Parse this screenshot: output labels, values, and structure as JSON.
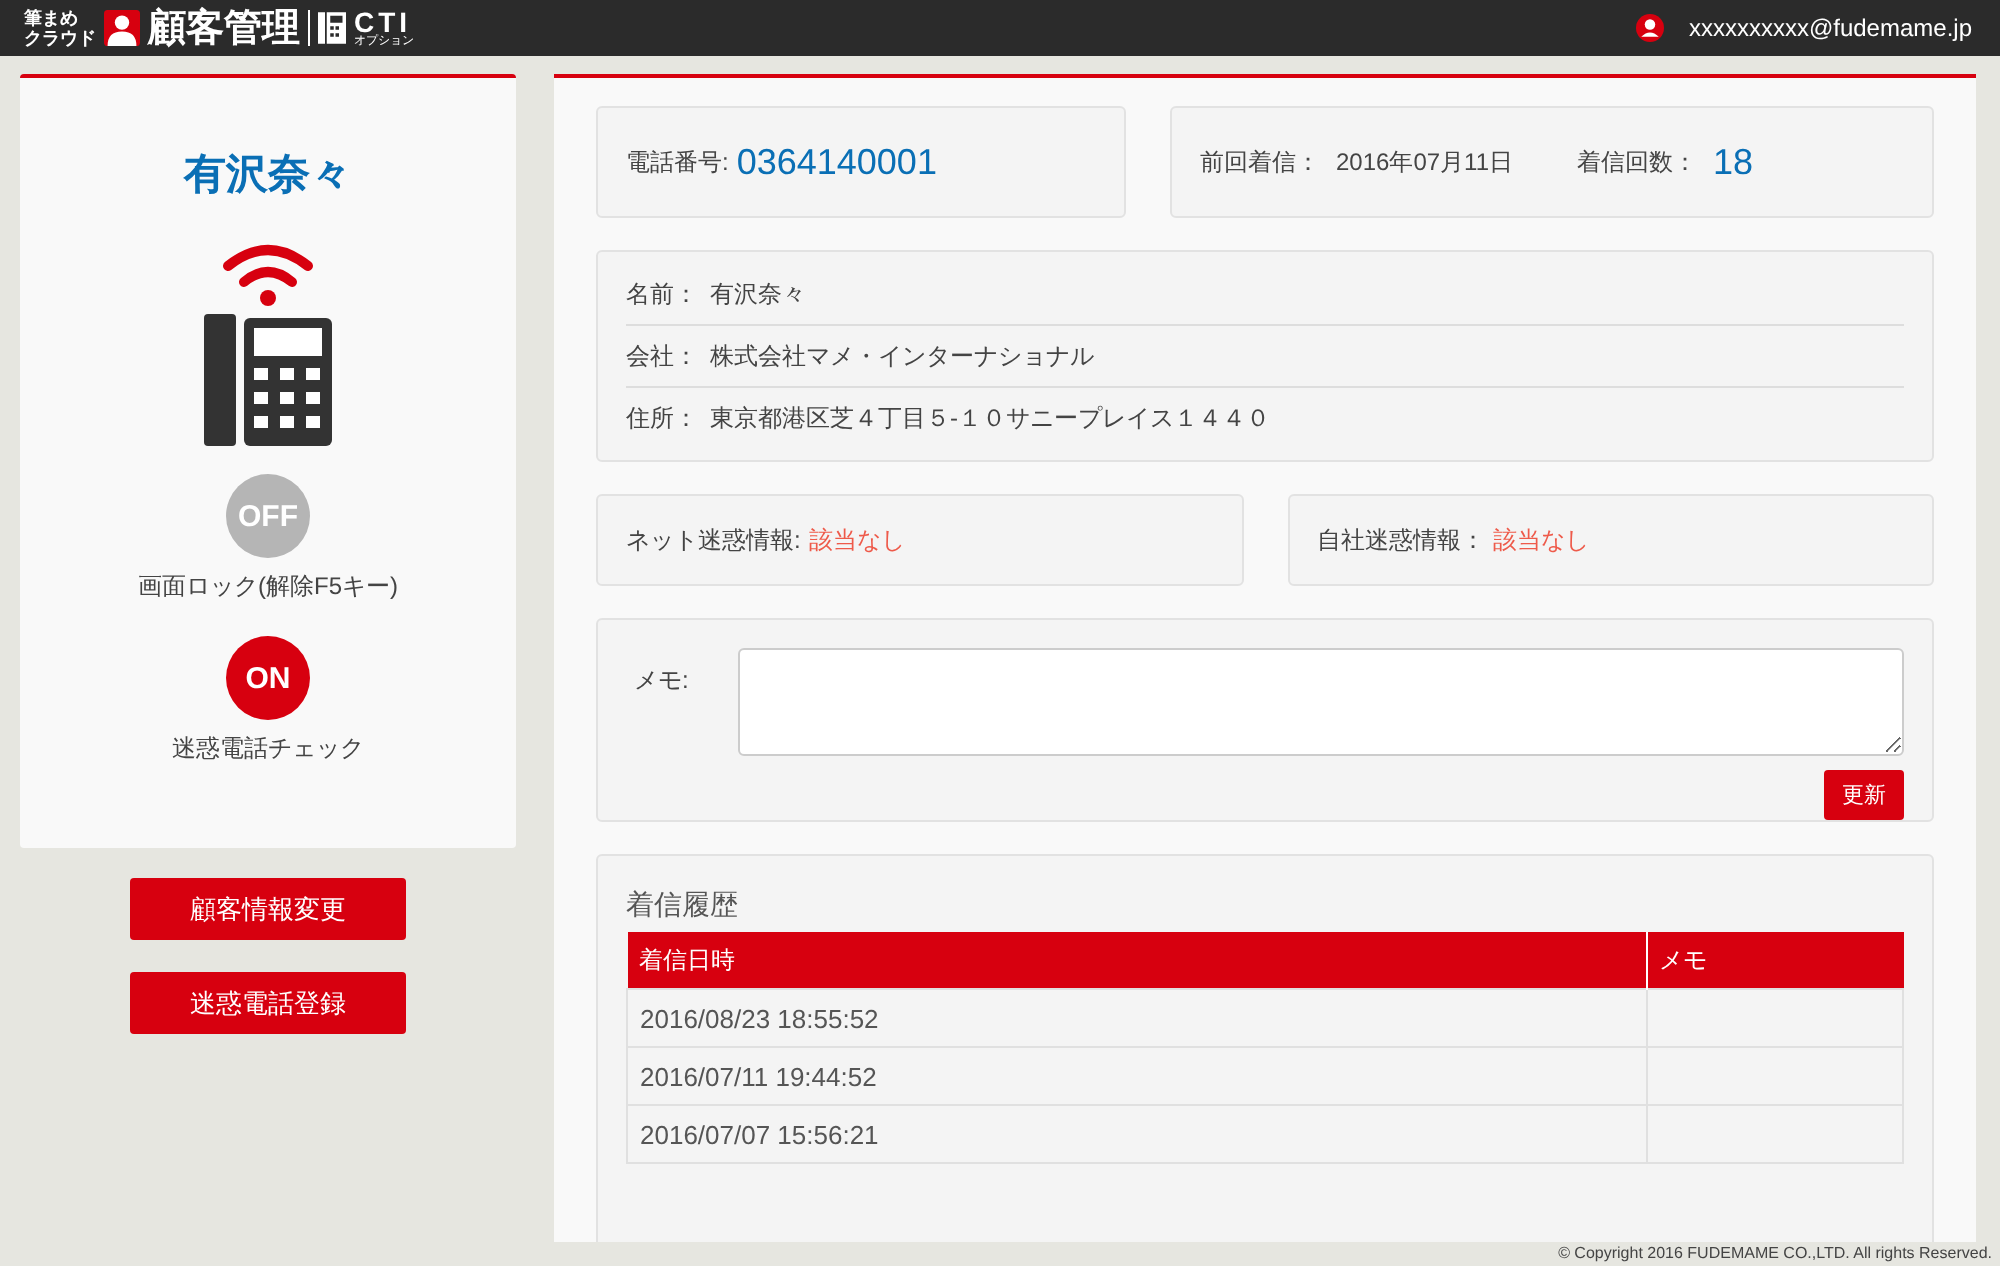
{
  "header": {
    "logo_small_1": "筆まめ",
    "logo_small_2": "クラウド",
    "logo_title": "顧客管理",
    "logo_cti": "CTI",
    "logo_cti_sub": "オプション",
    "user_email": "xxxxxxxxxx@fudemame.jp"
  },
  "caller": {
    "name": "有沢奈々"
  },
  "toggles": [
    {
      "switch_label": "OFF",
      "label": "画面ロック(解除F5キー)",
      "on": false
    },
    {
      "switch_label": "ON",
      "label": "迷惑電話チェック",
      "on": true
    }
  ],
  "side_buttons": [
    "顧客情報変更",
    "迷惑電話登録"
  ],
  "phone": {
    "label": "電話番号:",
    "value": "0364140001"
  },
  "last_call": {
    "label": "前回着信：",
    "value": "2016年07月11日",
    "count_label": "着信回数：",
    "count": "18"
  },
  "info": [
    {
      "label": "名前：",
      "value": "有沢奈々"
    },
    {
      "label": "会社：",
      "value": "株式会社マメ・インターナショナル"
    },
    {
      "label": "住所：",
      "value": "東京都港区芝４丁目５-１０サニープレイス１４４０"
    }
  ],
  "warnings": [
    {
      "label": "ネット迷惑情報:",
      "value": "該当なし"
    },
    {
      "label": "自社迷惑情報：",
      "value": "該当なし"
    }
  ],
  "memo": {
    "label": "メモ:",
    "button": "更新"
  },
  "history": {
    "title": "着信履歴",
    "columns": [
      "着信日時",
      "メモ"
    ],
    "rows": [
      [
        "2016/08/23 18:55:52"
      ],
      [
        "2016/07/11 19:44:52"
      ],
      [
        "2016/07/07 15:56:21"
      ]
    ]
  },
  "footer": "© Copyright 2016 FUDEMAME CO.,LTD. All rights Reserved."
}
